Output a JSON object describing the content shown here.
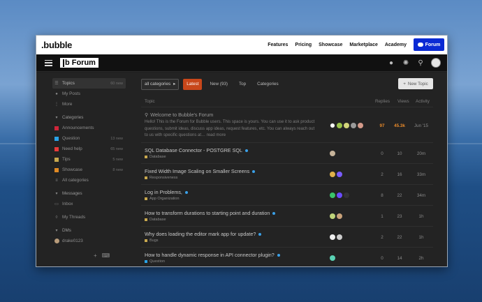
{
  "colors": {
    "accent": "#c8471a",
    "brand_button": "#0a2ad4",
    "unread_dot": "#3aa0e8"
  },
  "topbar": {
    "logo": ".bubble",
    "links": [
      "Features",
      "Pricing",
      "Showcase",
      "Marketplace",
      "Academy"
    ],
    "forum_button": "Forum"
  },
  "header": {
    "brand": "Forum",
    "brand_mark": "b",
    "icons": [
      "chat-icon",
      "settings-icon",
      "search-icon",
      "avatar"
    ]
  },
  "sidebar": {
    "topics": {
      "label": "Topics",
      "count": "60 new"
    },
    "my_posts": "My Posts",
    "more": "More",
    "categories_label": "Categories",
    "categories": [
      {
        "label": "Announcements",
        "count": "",
        "color": "#d0263a"
      },
      {
        "label": "Question",
        "count": "13 new",
        "color": "#2aa3e8"
      },
      {
        "label": "Need help",
        "count": "65 new",
        "color": "#e83a3a"
      },
      {
        "label": "Tips",
        "count": "5 new",
        "color": "#c8a84e"
      },
      {
        "label": "Showcase",
        "count": "8 new",
        "color": "#e08a24"
      },
      {
        "label": "All categories",
        "count": "",
        "color": ""
      }
    ],
    "messages_label": "Messages",
    "inbox": "Inbox",
    "my_threads": "My Threads",
    "dms_label": "DMs",
    "dm_user": "drake0123"
  },
  "controls": {
    "category_filter": "all categories",
    "tabs": [
      "Latest",
      "New (93)",
      "Top",
      "Categories"
    ],
    "new_topic": "New Topic"
  },
  "table": {
    "headers": {
      "topic": "Topic",
      "replies": "Replies",
      "views": "Views",
      "activity": "Activity"
    },
    "pinned": {
      "title": "Welcome to Bubble's Forum",
      "excerpt": "Hello! This is the Forum for Bubble users. This space is yours. You can use it to ask product questions, submit ideas, discuss app ideas, request features, etc. You can always reach out to us with specific questions at… read more",
      "replies": "97",
      "views": "45.3k",
      "activity": "Jun '15"
    },
    "rows": [
      {
        "title": "SQL Database Connector - POSTGRE SQL",
        "category": "Database",
        "cat_color": "#c8a84e",
        "replies": "0",
        "views": "10",
        "activity": "20m"
      },
      {
        "title": "Fixed Width Image Scaling on Smaller Screens",
        "category": "Responsiveness",
        "cat_color": "#c8a84e",
        "replies": "2",
        "views": "16",
        "activity": "33m"
      },
      {
        "title": "Log in Problems,",
        "category": "App Organization",
        "cat_color": "#c8a84e",
        "replies": "8",
        "views": "22",
        "activity": "34m"
      },
      {
        "title": "How to transform durations to starting point and duration",
        "category": "Database",
        "cat_color": "#c8a84e",
        "replies": "1",
        "views": "23",
        "activity": "1h"
      },
      {
        "title": "Why does loading the editor mark app for update?",
        "category": "Bugs",
        "cat_color": "#c8a84e",
        "replies": "2",
        "views": "22",
        "activity": "1h"
      },
      {
        "title": "How to handle dynamic response in API connector plugin?",
        "category": "Question",
        "cat_color": "#2aa3e8",
        "replies": "0",
        "views": "14",
        "activity": "2h"
      }
    ]
  }
}
